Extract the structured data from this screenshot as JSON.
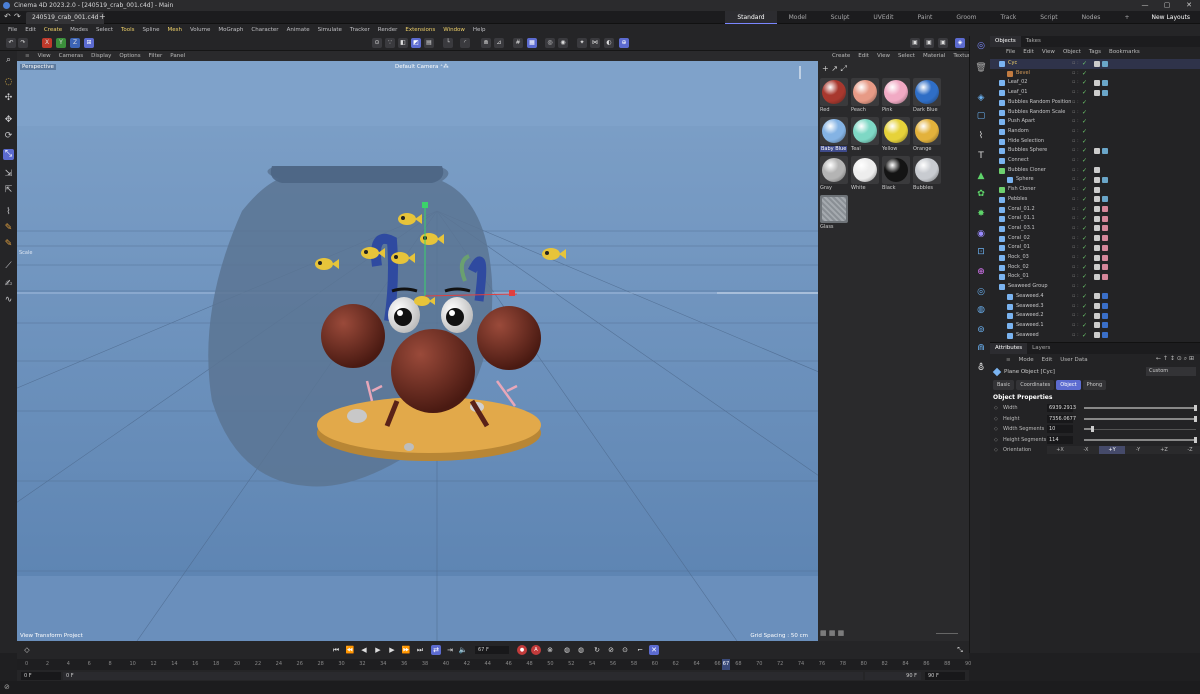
{
  "window": {
    "title": "Cinema 4D 2023.2.0 - [240519_crab_001.c4d] - Main",
    "controls": [
      "—",
      "▢",
      "✕"
    ]
  },
  "doc_tab": {
    "label": "240519_crab_001.c4d",
    "add": "+"
  },
  "layouts": {
    "items": [
      "Standard",
      "Model",
      "Sculpt",
      "UVEdit",
      "Paint",
      "Groom",
      "Track",
      "Script",
      "Nodes"
    ],
    "active": "Standard",
    "add": "+",
    "new_layouts": "New Layouts"
  },
  "menubar": [
    "File",
    "Edit",
    "Create",
    "Modes",
    "Select",
    "Tools",
    "Spline",
    "Mesh",
    "Volume",
    "MoGraph",
    "Character",
    "Animate",
    "Simulate",
    "Tracker",
    "Render",
    "Extensions",
    "Window",
    "Help"
  ],
  "toolbar": {
    "axes": [
      "X",
      "Y",
      "Z"
    ]
  },
  "viewport": {
    "menu": [
      "View",
      "Cameras",
      "Display",
      "Options",
      "Filter",
      "Panel"
    ],
    "projection": "Perspective",
    "camera": "Default Camera ⁺⁂",
    "status": "View Transform Project",
    "grid_spacing": "Grid Spacing : 50 cm",
    "scale_label": "Scale",
    "colors": {
      "background": "#7ea1c9",
      "floor": "#6a8ebb",
      "bowl": "#5b7493",
      "sand": "#e2a94a",
      "crab": "#6b2a20"
    }
  },
  "materials": {
    "menu": [
      "Create",
      "Edit",
      "View",
      "Select",
      "Material",
      "Texture"
    ],
    "items": [
      {
        "name": "Red",
        "color": "#a8382e"
      },
      {
        "name": "Peach",
        "color": "#e79a86"
      },
      {
        "name": "Pink",
        "color": "#f1aac4"
      },
      {
        "name": "Dark Blue",
        "color": "#2f6ec6"
      },
      {
        "name": "Baby Blue",
        "color": "#84b3e4",
        "selected": true
      },
      {
        "name": "Teal",
        "color": "#7ed8c5"
      },
      {
        "name": "Yellow",
        "color": "#e6d23a"
      },
      {
        "name": "Orange",
        "color": "#e3b23c"
      },
      {
        "name": "Gray",
        "color": "#b4b4b4"
      },
      {
        "name": "White",
        "color": "#ededed"
      },
      {
        "name": "Black",
        "color": "#141414"
      },
      {
        "name": "Bubbles",
        "color": "#c8cbd0"
      },
      {
        "name": "Glass",
        "color": "#9aa0a6"
      }
    ]
  },
  "objects": {
    "tabs": [
      "Objects",
      "Takes"
    ],
    "menu": [
      "File",
      "Edit",
      "View",
      "Object",
      "Tags",
      "Bookmarks"
    ],
    "rows": [
      {
        "name": "Cyc",
        "indent": 0,
        "icon": "#7ab3f0",
        "sel": true,
        "text_color": "#f0d26a"
      },
      {
        "name": "Bevel",
        "indent": 1,
        "icon": "#c27b40",
        "text_color": "#d59b5a"
      },
      {
        "name": "Leaf_02",
        "indent": 0,
        "icon": "#7ab3f0"
      },
      {
        "name": "Leaf_01",
        "indent": 0,
        "icon": "#7ab3f0"
      },
      {
        "name": "Bubbles Random Position",
        "indent": 0,
        "icon": "#7ab3f0"
      },
      {
        "name": "Bubbles Random Scale",
        "indent": 0,
        "icon": "#7ab3f0"
      },
      {
        "name": "Push Apart",
        "indent": 0,
        "icon": "#7ab3f0"
      },
      {
        "name": "Random",
        "indent": 0,
        "icon": "#7ab3f0"
      },
      {
        "name": "Hide Selection",
        "indent": 0,
        "icon": "#7ab3f0"
      },
      {
        "name": "Bubbles Sphere",
        "indent": 0,
        "icon": "#7ab3f0"
      },
      {
        "name": "Connect",
        "indent": 0,
        "icon": "#7ab3f0"
      },
      {
        "name": "Bubbles Cloner",
        "indent": 0,
        "icon": "#6fd06f"
      },
      {
        "name": "Sphere",
        "indent": 1,
        "icon": "#7ab3f0"
      },
      {
        "name": "Fish Cloner",
        "indent": 0,
        "icon": "#6fd06f"
      },
      {
        "name": "Pebbles",
        "indent": 0,
        "icon": "#7ab3f0"
      },
      {
        "name": "Coral_01.2",
        "indent": 0,
        "icon": "#7ab3f0"
      },
      {
        "name": "Coral_01.1",
        "indent": 0,
        "icon": "#7ab3f0"
      },
      {
        "name": "Coral_03.1",
        "indent": 0,
        "icon": "#7ab3f0"
      },
      {
        "name": "Coral_02",
        "indent": 0,
        "icon": "#7ab3f0"
      },
      {
        "name": "Coral_01",
        "indent": 0,
        "icon": "#7ab3f0"
      },
      {
        "name": "Rock_03",
        "indent": 0,
        "icon": "#7ab3f0"
      },
      {
        "name": "Rock_02",
        "indent": 0,
        "icon": "#7ab3f0"
      },
      {
        "name": "Rock_01",
        "indent": 0,
        "icon": "#7ab3f0"
      },
      {
        "name": "Seaweed Group",
        "indent": 0,
        "icon": "#7ab3f0"
      },
      {
        "name": "Seaweed.4",
        "indent": 1,
        "icon": "#7ab3f0"
      },
      {
        "name": "Seaweed.3",
        "indent": 1,
        "icon": "#7ab3f0"
      },
      {
        "name": "Seaweed.2",
        "indent": 1,
        "icon": "#7ab3f0"
      },
      {
        "name": "Seaweed.1",
        "indent": 1,
        "icon": "#7ab3f0"
      },
      {
        "name": "Seaweed",
        "indent": 1,
        "icon": "#7ab3f0"
      }
    ]
  },
  "attributes": {
    "tabs": [
      "Attributes",
      "Layers"
    ],
    "menu": [
      "Mode",
      "Edit",
      "User Data"
    ],
    "object_label": "Plane Object [Cyc]",
    "preset": "Custom",
    "subtabs": [
      "Basic",
      "Coordinates",
      "Object",
      "Phong"
    ],
    "active_subtab": "Object",
    "section": "Object Properties",
    "props": [
      {
        "label": "Width",
        "value": "6939.2913",
        "level": 1.0
      },
      {
        "label": "Height",
        "value": "7356.0677",
        "level": 1.0
      },
      {
        "label": "Width Segments",
        "value": "10",
        "level": 0.08
      },
      {
        "label": "Height Segments",
        "value": "114",
        "level": 1.0
      }
    ],
    "orientation": {
      "label": "Orientation",
      "options": [
        "+X",
        "-X",
        "+Y",
        "-Y",
        "+Z",
        "-Z"
      ],
      "active": "+Y"
    }
  },
  "playback": {
    "current_frame": "67 F"
  },
  "timeline": {
    "ticks": [
      "0",
      "2",
      "4",
      "6",
      "8",
      "10",
      "12",
      "14",
      "16",
      "18",
      "20",
      "22",
      "24",
      "26",
      "28",
      "30",
      "32",
      "34",
      "36",
      "38",
      "40",
      "42",
      "44",
      "46",
      "48",
      "50",
      "52",
      "54",
      "56",
      "58",
      "60",
      "62",
      "64",
      "66",
      "68",
      "70",
      "72",
      "74",
      "76",
      "78",
      "80",
      "82",
      "84",
      "86",
      "88",
      "90"
    ],
    "marker": "67",
    "start": "0 F",
    "start2": "0 F",
    "end": "90 F",
    "end2": "90 F"
  }
}
